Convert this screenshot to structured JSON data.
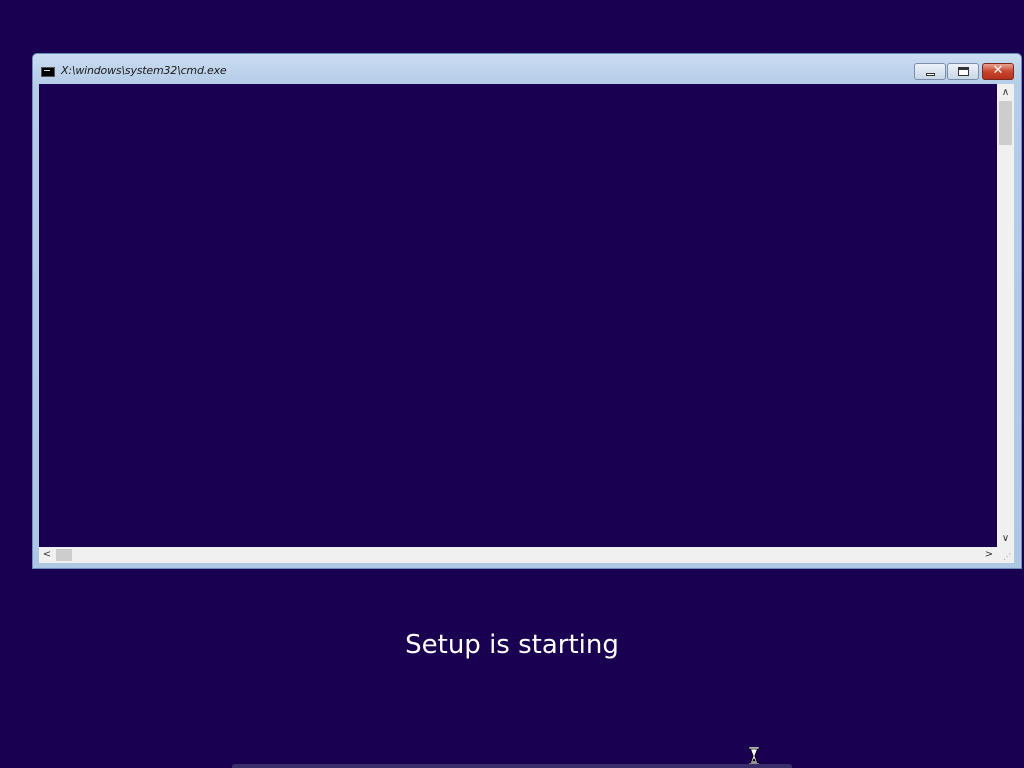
{
  "cmd_window": {
    "title": "X:\\windows\\system32\\cmd.exe",
    "icon": "console-icon",
    "controls": {
      "minimize_icon": "minimize-icon",
      "maximize_icon": "maximize-icon",
      "close_glyph": "✕"
    },
    "console_background": "#1a0050"
  },
  "setup": {
    "message": "Setup is starting"
  },
  "colors": {
    "background": "#1a0050",
    "close_button": "#c9452c"
  },
  "cursor": {
    "icon": "hourglass-icon"
  }
}
